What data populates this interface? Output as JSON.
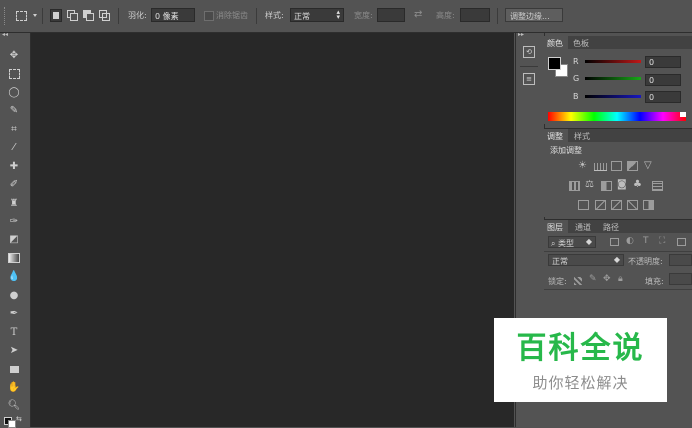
{
  "options_bar": {
    "feather_label": "羽化:",
    "feather_value": "0 像素",
    "antialias_label": "消除锯齿",
    "style_label": "样式:",
    "style_value": "正常",
    "width_label": "宽度:",
    "height_label": "高度:",
    "refine_edge_label": "调整边缘..."
  },
  "color_panel": {
    "tabs": [
      "颜色",
      "色板"
    ],
    "channels": [
      {
        "label": "R",
        "value": "0"
      },
      {
        "label": "G",
        "value": "0"
      },
      {
        "label": "B",
        "value": "0"
      }
    ],
    "colors": {
      "red": "#c01818",
      "green": "#18a818",
      "blue": "#1818c0"
    }
  },
  "adjustments_panel": {
    "tabs": [
      "调整",
      "样式"
    ],
    "heading": "添加调整"
  },
  "layers_panel": {
    "tabs": [
      "图层",
      "通道",
      "路径"
    ],
    "filter_label": "类型",
    "blend_mode": "正常",
    "opacity_label": "不透明度:",
    "lock_label": "锁定:",
    "fill_label": "填充:"
  },
  "watermark": {
    "title": "百科全说",
    "subtitle": "助你轻松解决",
    "title_color": "#27b84a"
  }
}
